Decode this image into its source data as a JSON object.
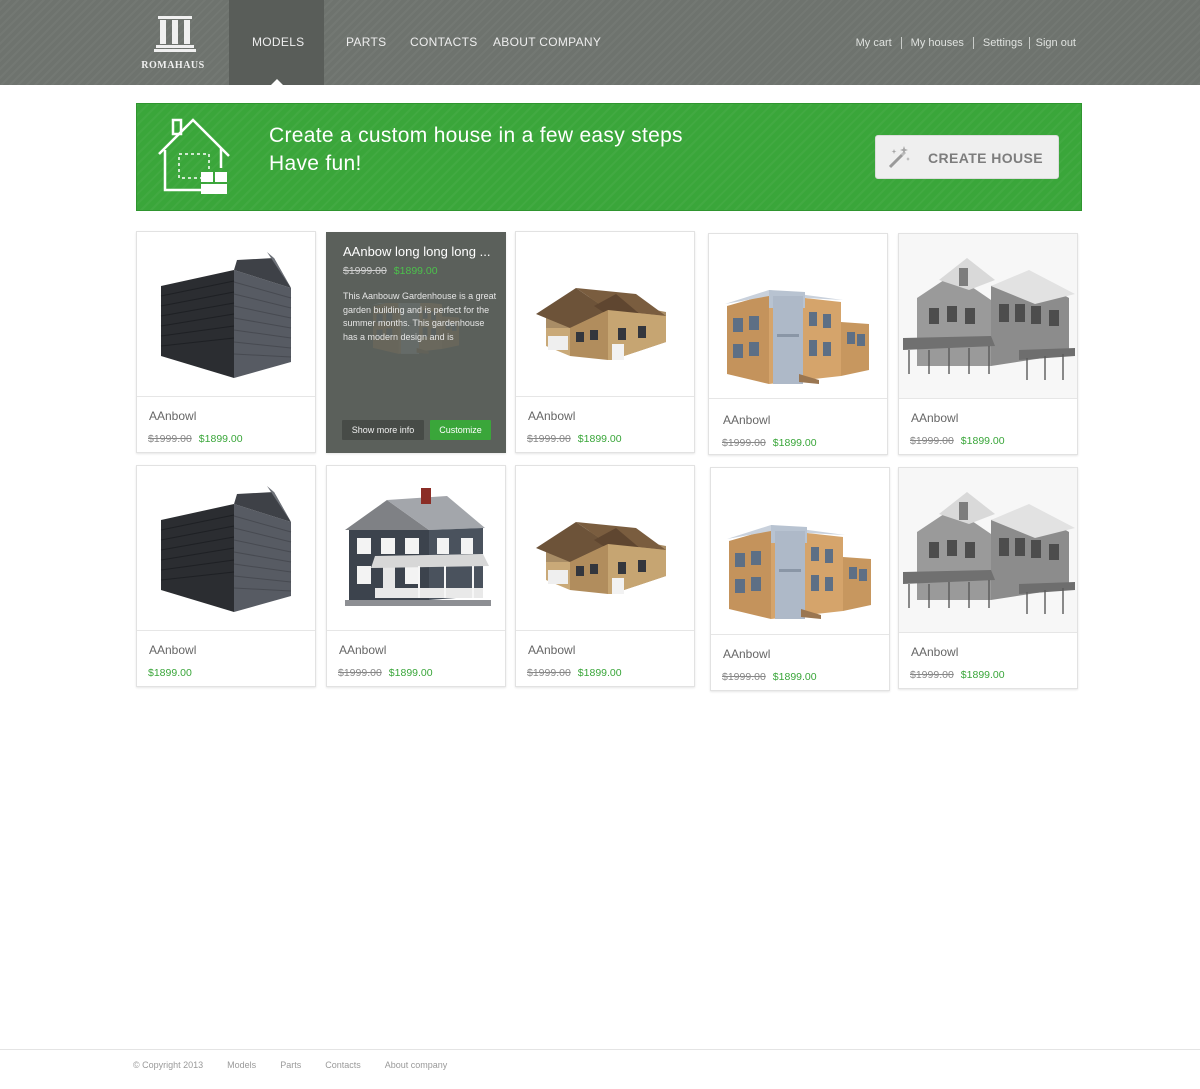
{
  "header": {
    "logo_text": "ROMAHAUS",
    "nav": [
      {
        "label": "MODELS",
        "active": true
      },
      {
        "label": "PARTS"
      },
      {
        "label": "CONTACTS"
      },
      {
        "label": "ABOUT COMPANY"
      }
    ],
    "user_links": [
      "My cart",
      "My houses",
      "Settings",
      "Sign out"
    ]
  },
  "banner": {
    "line1": "Create a custom house in a few easy steps",
    "line2": "Have fun!",
    "button_label": "CREATE HOUSE",
    "icon": "house-icon"
  },
  "cards": [
    {
      "title": "AAnbowl",
      "old_price": "$1999.00",
      "price": "$1899.00",
      "image": "black-shed"
    },
    {
      "title": "AAnbow long long long ...",
      "old_price": "$1999.00",
      "price": "$1899.00",
      "image": "modern-house",
      "hover": true,
      "description": "This Aanbouw Gardenhouse is a great garden building and is perfect for the summer months. This gardenhouse has a modern design and is",
      "more_label": "Show more info",
      "customize_label": "Customize"
    },
    {
      "title": "AAnbowl",
      "old_price": "$1999.00",
      "price": "$1899.00",
      "image": "brown-house"
    },
    {
      "title": "AAnbowl",
      "old_price": "$1999.00",
      "price": "$1899.00",
      "image": "wood-modern-house"
    },
    {
      "title": "AAnbowl",
      "old_price": "$1999.00",
      "price": "$1899.00",
      "image": "victorian-house"
    },
    {
      "title": "AAnbowl",
      "old_price": "",
      "price": "$1899.00",
      "image": "black-shed"
    },
    {
      "title": "AAnbowl",
      "old_price": "$1999.00",
      "price": "$1899.00",
      "image": "grey-colonial-house"
    },
    {
      "title": "AAnbowl",
      "old_price": "$1999.00",
      "price": "$1899.00",
      "image": "brown-house"
    },
    {
      "title": "AAnbowl",
      "old_price": "$1999.00",
      "price": "$1899.00",
      "image": "wood-modern-house"
    },
    {
      "title": "AAnbowl",
      "old_price": "$1999.00",
      "price": "$1899.00",
      "image": "victorian-house"
    }
  ],
  "footer": {
    "copyright": "© Copyright 2013",
    "links": [
      "Models",
      "Parts",
      "Contacts",
      "About company"
    ]
  },
  "colors": {
    "header": "#6e736e",
    "accent_green": "#3aa63a",
    "hover_card": "#5b605b"
  }
}
